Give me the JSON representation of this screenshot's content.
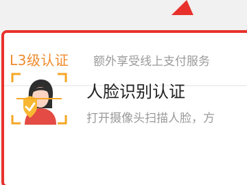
{
  "level": {
    "title": "L3级认证",
    "subtitle": "额外享受线上支付服务"
  },
  "auth_item": {
    "title": "人脸识别认证",
    "description": "打开摄像头扫描人脸，方",
    "icon": "face-recognition-icon"
  },
  "colors": {
    "accent_red": "#e8312b",
    "level_orange": "#f08a2b",
    "face_frame": "#f5a623"
  }
}
